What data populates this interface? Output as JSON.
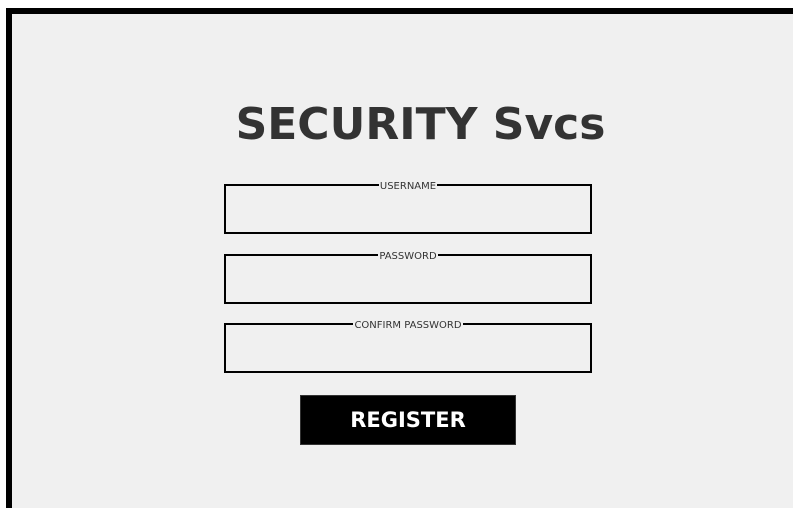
{
  "app": {
    "title": "SECURITY Svcs"
  },
  "form": {
    "username": {
      "label": "USERNAME",
      "value": "",
      "placeholder": ""
    },
    "password": {
      "label": "PASSWORD",
      "value": "",
      "placeholder": ""
    },
    "confirm_password": {
      "label": "CONFIRM PASSWORD",
      "value": "",
      "placeholder": ""
    },
    "register_label": "REGISTER"
  },
  "colors": {
    "background": "#f0f0f0",
    "frame": "#000000",
    "title_text": "#333333",
    "button_bg": "#000000",
    "button_text": "#ffffff"
  }
}
